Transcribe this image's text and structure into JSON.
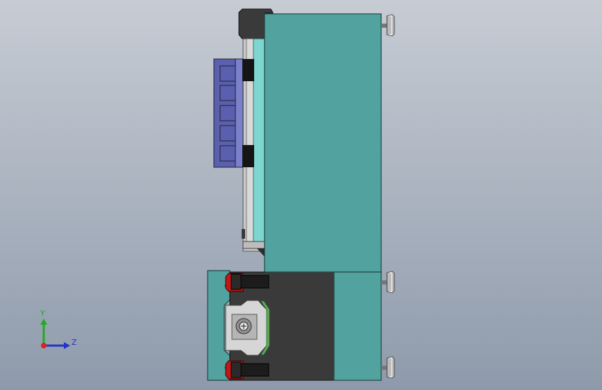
{
  "viewport": {
    "background_top": "#c7ccd4",
    "background_bottom": "#8e9aab"
  },
  "colors": {
    "teal_plate": "#52a3a0",
    "teal_light": "#7fd6cf",
    "dark_body": "#3a3a3a",
    "black_block": "#1c1c1c",
    "purple_bracket": "#5a5fb0",
    "purple_light": "#7a80cc",
    "red_clamp": "#c01818",
    "green_insert": "#6aa84f",
    "gray_metal": "#c8c8c8",
    "axis_y": "#22aa22",
    "axis_z": "#2233cc",
    "axis_origin": "#dd2222"
  },
  "triad": {
    "y_label": "Y",
    "z_label": "Z"
  },
  "icons": {
    "screw": "screw-icon",
    "origin": "origin-icon"
  }
}
